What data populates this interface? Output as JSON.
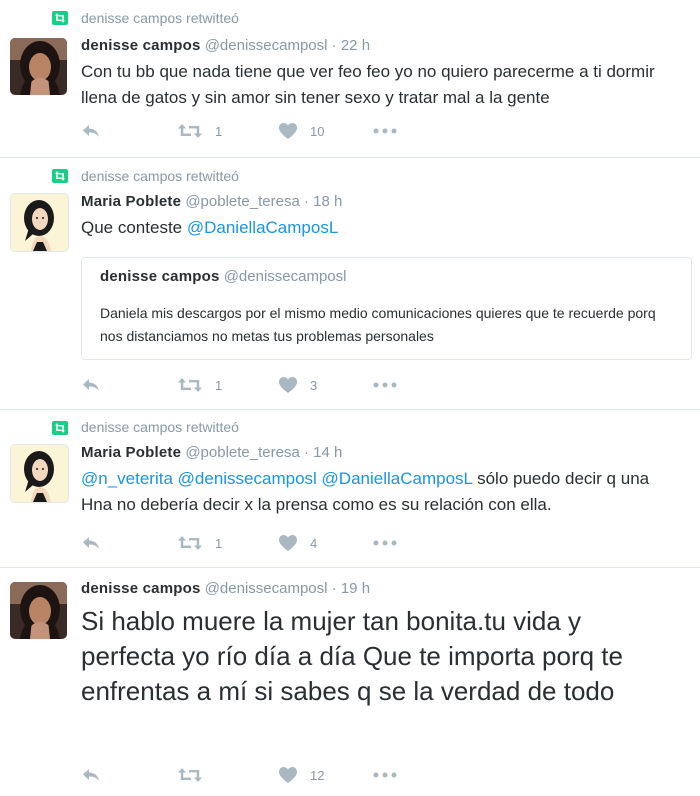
{
  "tweets": [
    {
      "context": "denisse campos retwitteó",
      "name": "denisse campos",
      "handle": "@denissecamposl",
      "dot": "·",
      "time": "22 h",
      "text": "Con tu bb que nada tiene que ver feo feo yo no quiero parecerme a ti dormir llena de gatos y sin amor sin tener sexo y tratar mal a la gente",
      "retweets": "1",
      "likes": "10"
    },
    {
      "context": "denisse campos retwitteó",
      "name": "Maria Poblete",
      "handle": "@poblete_teresa",
      "dot": "·",
      "time": "18 h",
      "text_prefix": "Que conteste ",
      "text_mention": "@DaniellaCamposL",
      "quote": {
        "name": "denisse campos",
        "handle": "@denissecamposl",
        "text": "Daniela mis descargos por el mismo medio comunicaciones quieres que te recuerde porq nos distanciamos no metas tus problemas personales"
      },
      "retweets": "1",
      "likes": "3"
    },
    {
      "context": "denisse campos retwitteó",
      "name": "Maria Poblete",
      "handle": "@poblete_teresa",
      "dot": "·",
      "time": "14 h",
      "mention1": "@n_veterita",
      "mention2": "@denissecamposl",
      "mention3": "@DaniellaCamposL",
      "text_rest": " sólo puedo decir q una Hna no debería decir x la prensa como es su relación con ella.",
      "retweets": "1",
      "likes": "4"
    },
    {
      "name": "denisse campos",
      "handle": "@denissecamposl",
      "dot": "·",
      "time": "19 h",
      "text": "Si hablo muere la mujer tan bonita.tu vida y perfecta yo río día a día Que te importa porq te enfrentas a mí si sabes q se la verdad de todo",
      "retweets": "",
      "likes": "12"
    }
  ],
  "icons": {
    "retweet_badge": "retweet-badge-icon",
    "reply": "reply-icon",
    "retweet": "retweet-icon",
    "like": "heart-icon",
    "more": "more-dots-icon"
  },
  "colors": {
    "retweet_green": "#19cf86",
    "action_grey": "#aab8c2",
    "link_blue": "#1b95e0",
    "meta_grey": "#8899a6"
  }
}
